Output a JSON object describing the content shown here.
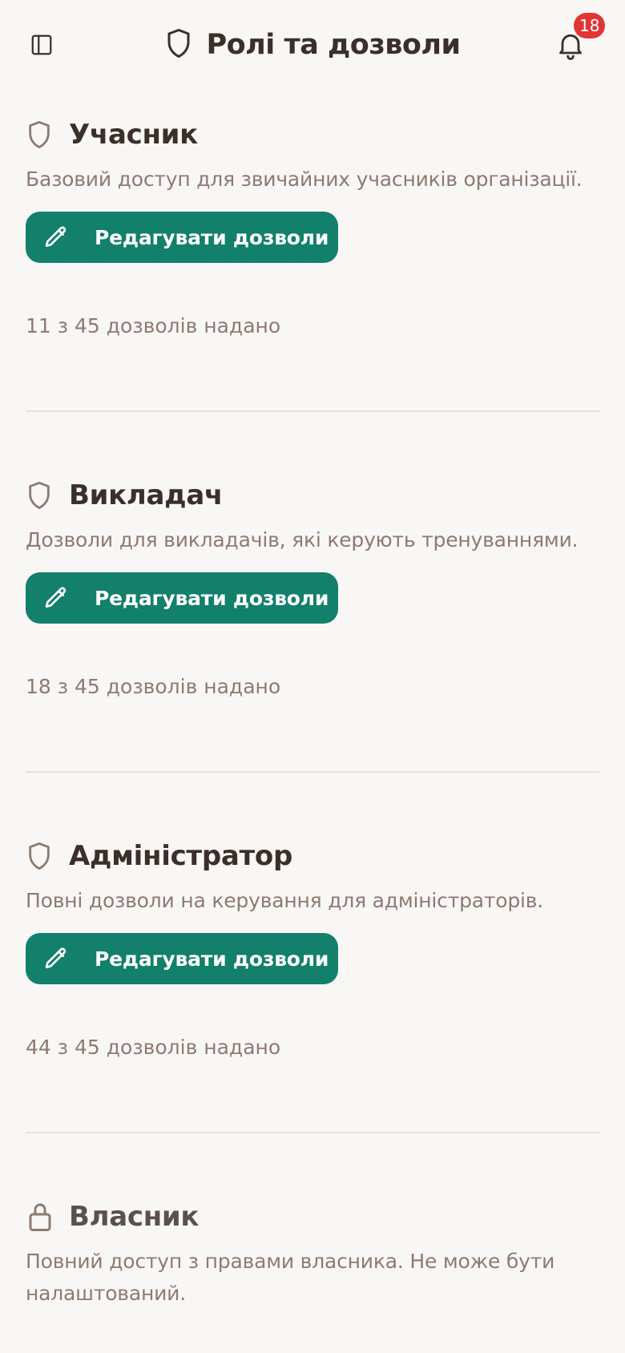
{
  "header": {
    "title": "Ролі та дозволи",
    "notifications_count": "18"
  },
  "roles": [
    {
      "name": "Учасник",
      "description": "Базовий доступ для звичайних учасників організації.",
      "edit_label": "Редагувати дозволи",
      "count_text": "11 з 45 дозволів надано",
      "icon": "shield-icon"
    },
    {
      "name": "Викладач",
      "description": "Дозволи для викладачів, які керують тренуваннями.",
      "edit_label": "Редагувати дозволи",
      "count_text": "18 з 45 дозволів надано",
      "icon": "shield-icon"
    },
    {
      "name": "Адміністратор",
      "description": "Повні дозволи на керування для адміністраторів.",
      "edit_label": "Редагувати дозволи",
      "count_text": "44 з 45 дозволів надано",
      "icon": "shield-icon"
    },
    {
      "name": "Власник",
      "description": "Повний доступ з правами власника. Не може бути налаштований.",
      "icon": "lock-icon"
    }
  ],
  "colors": {
    "accent": "#12806b",
    "badge": "#e03535",
    "muted_text": "#8d7a72",
    "background": "#f9f7f5"
  }
}
